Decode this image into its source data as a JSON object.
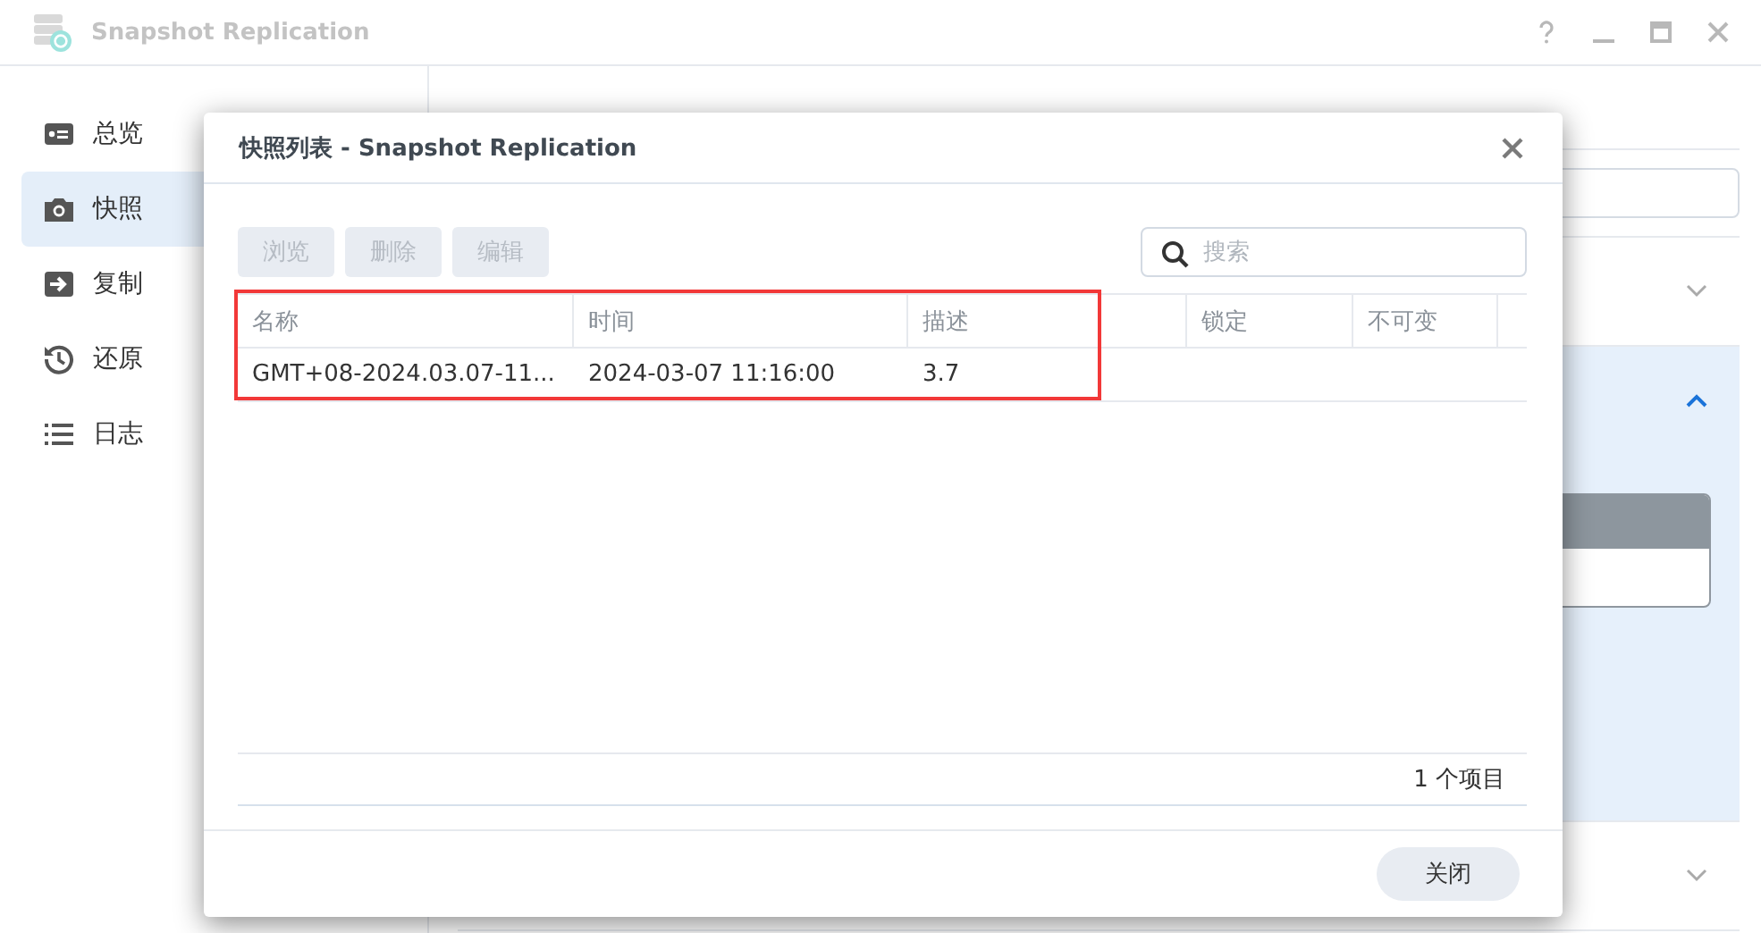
{
  "window": {
    "title": "Snapshot Replication"
  },
  "sidebar": {
    "items": [
      {
        "label": "总览",
        "selected": false
      },
      {
        "label": "快照",
        "selected": true
      },
      {
        "label": "复制",
        "selected": false
      },
      {
        "label": "还原",
        "selected": false
      },
      {
        "label": "日志",
        "selected": false
      }
    ]
  },
  "sections": [
    {
      "expanded": false
    },
    {
      "expanded": true
    },
    {
      "expanded": false
    }
  ],
  "dialog": {
    "title": "快照列表 - Snapshot Replication",
    "toolbar": [
      {
        "label": "浏览",
        "disabled": true
      },
      {
        "label": "删除",
        "disabled": true
      },
      {
        "label": "编辑",
        "disabled": true
      }
    ],
    "search": {
      "placeholder": "搜索"
    },
    "table": {
      "columns": [
        "名称",
        "时间",
        "描述",
        "锁定",
        "不可变"
      ],
      "rows": [
        {
          "cells": [
            "GMT+08-2024.03.07-11...",
            "2024-03-07 11:16:00",
            "3.7",
            "",
            ""
          ],
          "selected": false
        }
      ]
    },
    "item_count": "1 个项目",
    "buttons": [
      "关闭"
    ]
  }
}
